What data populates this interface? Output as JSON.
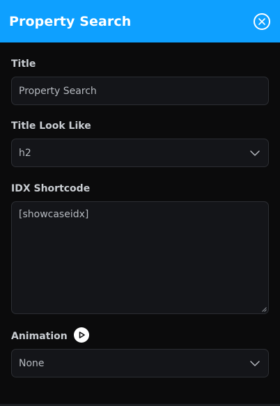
{
  "header": {
    "title": "Property Search"
  },
  "fields": {
    "title": {
      "label": "Title",
      "value": "Property Search"
    },
    "title_look": {
      "label": "Title Look Like",
      "selected": "h2"
    },
    "idx_shortcode": {
      "label": "IDX Shortcode",
      "value": "[showcaseidx]"
    },
    "animation": {
      "label": "Animation",
      "selected": "None"
    }
  },
  "colors": {
    "header_bg": "#0ea0ff",
    "panel_bg": "#0b0b0c",
    "field_bg": "#141519",
    "field_border": "#2c2e33",
    "label_text": "#c9cdd2",
    "value_text": "#b6bac0"
  },
  "icons": {
    "close": "close-circle-icon",
    "chevron": "chevron-down-icon",
    "play": "play-circle-icon",
    "resize": "resize-grip-icon"
  }
}
